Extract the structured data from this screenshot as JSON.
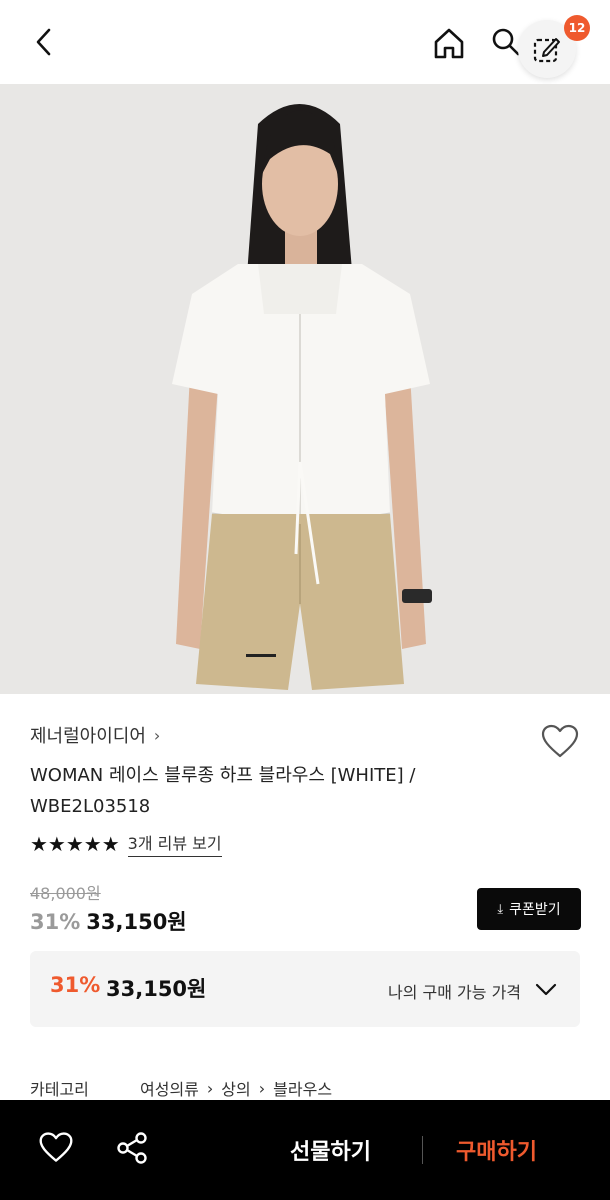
{
  "topbar": {
    "back_icon": "chevron-left-icon",
    "home_icon": "home-icon",
    "search_icon": "search-icon",
    "floating_icon": "edit-select-icon",
    "badge_count": "12"
  },
  "product": {
    "brand": "제너럴아이디어",
    "title": "WOMAN 레이스 블루종 하프 블라우스 [WHITE] / WBE2L03518",
    "stars": "★★★★★",
    "review_link": "3개 리뷰 보기",
    "original_price": "48,000원",
    "discount": "31%",
    "sale_price": "33,150원"
  },
  "coupon": {
    "label": "쿠폰받기",
    "icon": "download-icon"
  },
  "my_price": {
    "discount": "31%",
    "price": "33,150원",
    "label": "나의 구매 가능 가격"
  },
  "category": {
    "label": "카테고리",
    "crumbs": [
      "여성의류",
      "상의",
      "블라우스"
    ]
  },
  "bottom_bar": {
    "gift_label": "선물하기",
    "buy_label": "구매하기",
    "heart_icon": "heart-outline-icon",
    "share_icon": "share-icon"
  },
  "colors": {
    "accent": "#ef5a2e",
    "dark": "#0a0a0a"
  }
}
